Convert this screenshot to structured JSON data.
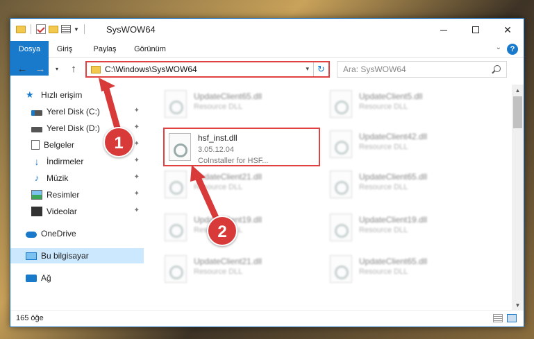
{
  "window": {
    "title": "SysWOW64",
    "controls": {
      "minimize": "–",
      "maximize": "□",
      "close": "✕"
    }
  },
  "ribbon": {
    "tabs": [
      "Dosya",
      "Giriş",
      "Paylaş",
      "Görünüm"
    ],
    "help": "?",
    "collapse": "⌄"
  },
  "address": {
    "path": "C:\\Windows\\SysWOW64",
    "refresh": "↻",
    "dropdown": "▾"
  },
  "search": {
    "placeholder": "Ara: SysWOW64"
  },
  "nav_buttons": {
    "back": "←",
    "forward": "→",
    "recent": "▾",
    "up": "↑"
  },
  "sidebar": {
    "items": [
      {
        "label": "Hızlı erişim",
        "icon": "star-icon",
        "pinned": false
      },
      {
        "label": "Yerel Disk (C:)",
        "icon": "drive-icon",
        "pinned": true
      },
      {
        "label": "Yerel Disk (D:)",
        "icon": "drive-icon",
        "pinned": true
      },
      {
        "label": "Belgeler",
        "icon": "document-icon",
        "pinned": true
      },
      {
        "label": "İndirmeler",
        "icon": "download-icon",
        "pinned": true
      },
      {
        "label": "Müzik",
        "icon": "music-icon",
        "pinned": true
      },
      {
        "label": "Resimler",
        "icon": "picture-icon",
        "pinned": true
      },
      {
        "label": "Videolar",
        "icon": "video-icon",
        "pinned": true
      },
      {
        "label": "OneDrive",
        "icon": "cloud-icon",
        "pinned": false
      },
      {
        "label": "Bu bilgisayar",
        "icon": "computer-icon",
        "pinned": false
      },
      {
        "label": "Ağ",
        "icon": "network-icon",
        "pinned": false
      }
    ],
    "pin_glyph": "📌"
  },
  "files": [
    {
      "name": "UpdateClient65.dll",
      "type": "Resource DLL"
    },
    {
      "name": "UpdateClient5.dll",
      "type": "Resource DLL"
    },
    {
      "name": "hsf_inst.dll",
      "version": "3.05.12.04",
      "description": "CoInstaller for HSF..."
    },
    {
      "name": "UpdateClient42.dll",
      "type": "Resource DLL"
    },
    {
      "name": "UpdateClient21.dll",
      "type": "Resource DLL"
    },
    {
      "name": "UpdateClient65.dll",
      "type": "Resource DLL"
    },
    {
      "name": "UpdateClient19.dll",
      "type": "Resource DLL"
    },
    {
      "name": "UpdateClient19.dll",
      "type": "Resource DLL"
    },
    {
      "name": "UpdateClient21.dll",
      "type": "Resource DLL"
    },
    {
      "name": "UpdateClient65.dll",
      "type": "Resource DLL"
    }
  ],
  "status": {
    "item_count": "165 öğe"
  },
  "callouts": [
    "1",
    "2"
  ],
  "colors": {
    "accent": "#1979ca",
    "highlight": "#e04040",
    "callout": "#d83a3a"
  }
}
